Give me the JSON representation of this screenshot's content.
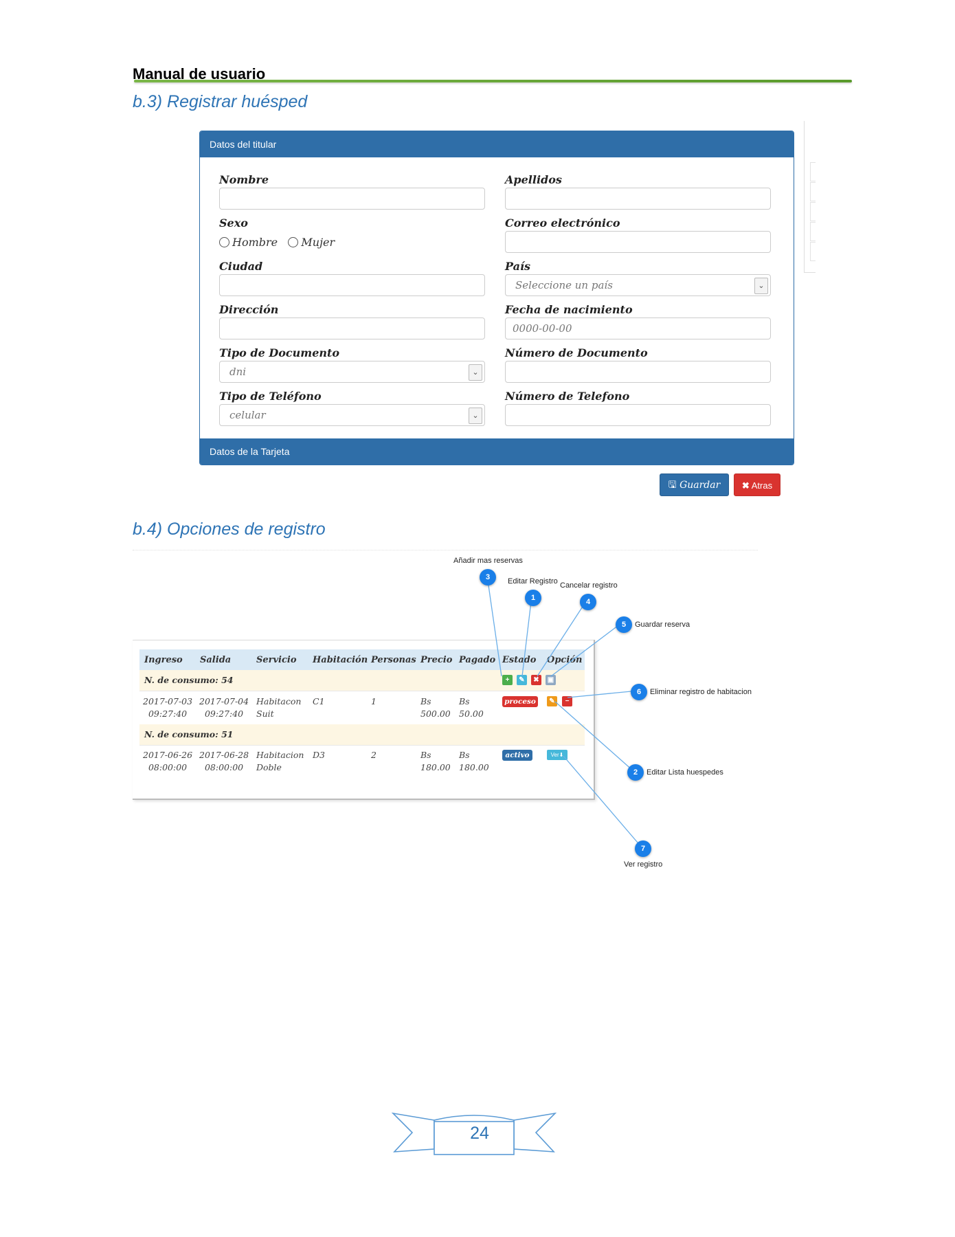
{
  "header": {
    "title": "Manual de usuario"
  },
  "section_b3": {
    "title": "b.3) Registrar huésped"
  },
  "form": {
    "panel_title": "Datos del titular",
    "footer_title": "Datos de la Tarjeta",
    "nombre_label": "Nombre",
    "apellidos_label": "Apellidos",
    "sexo_label": "Sexo",
    "sexo_hombre": "Hombre",
    "sexo_mujer": "Mujer",
    "correo_label": "Correo electrónico",
    "ciudad_label": "Ciudad",
    "pais_label": "País",
    "pais_value": "Seleccione un país",
    "direccion_label": "Dirección",
    "fecha_label": "Fecha de nacimiento",
    "fecha_placeholder": "0000-00-00",
    "tipo_doc_label": "Tipo de Documento",
    "tipo_doc_value": "dni",
    "num_doc_label": "Número de Documento",
    "tipo_tel_label": "Tipo de Teléfono",
    "tipo_tel_value": "celular",
    "num_tel_label": "Número de Telefono",
    "save_label": "Guardar",
    "back_label": "Atras"
  },
  "section_b4": {
    "title": "b.4) Opciones de registro"
  },
  "table": {
    "headers": [
      "Ingreso",
      "Salida",
      "Servicio",
      "Habitación",
      "Personas",
      "Precio",
      "Pagado",
      "Estado",
      "Opción"
    ],
    "groups": [
      {
        "label": "N. de consumo: 54",
        "row": {
          "ingreso": [
            "2017-07-03",
            "09:27:40"
          ],
          "salida": [
            "2017-07-04",
            "09:27:40"
          ],
          "servicio": [
            "Habitacon",
            "Suit"
          ],
          "habitacion": "C1",
          "personas": "1",
          "precio": [
            "Bs",
            "500.00"
          ],
          "pagado": [
            "Bs",
            "50.00"
          ],
          "estado": "proceso"
        }
      },
      {
        "label": "N. de consumo: 51",
        "row": {
          "ingreso": [
            "2017-06-26",
            "08:00:00"
          ],
          "salida": [
            "2017-06-28",
            "08:00:00"
          ],
          "servicio": [
            "Habitacion",
            "Doble"
          ],
          "habitacion": "D3",
          "personas": "2",
          "precio": [
            "Bs",
            "180.00"
          ],
          "pagado": [
            "Bs",
            "180.00"
          ],
          "estado": "activo",
          "ver_label": "Ver"
        }
      }
    ]
  },
  "callouts": [
    {
      "num": "3",
      "text": "Añadir mas reservas"
    },
    {
      "num": "1",
      "text": "Editar Registro"
    },
    {
      "num": "4",
      "text": "Cancelar registro"
    },
    {
      "num": "5",
      "text": "Guardar reserva"
    },
    {
      "num": "6",
      "text": "Eliminar registro de habitacion"
    },
    {
      "num": "2",
      "text": "Editar Lista huespedes"
    },
    {
      "num": "7",
      "text": "Ver registro"
    }
  ],
  "colors": {
    "accent": "#2f6ea8",
    "heading": "#2e74b5",
    "danger": "#d9332f",
    "callout": "#1a7fe8",
    "rule": "#7ab648"
  },
  "page": {
    "number": "24"
  }
}
